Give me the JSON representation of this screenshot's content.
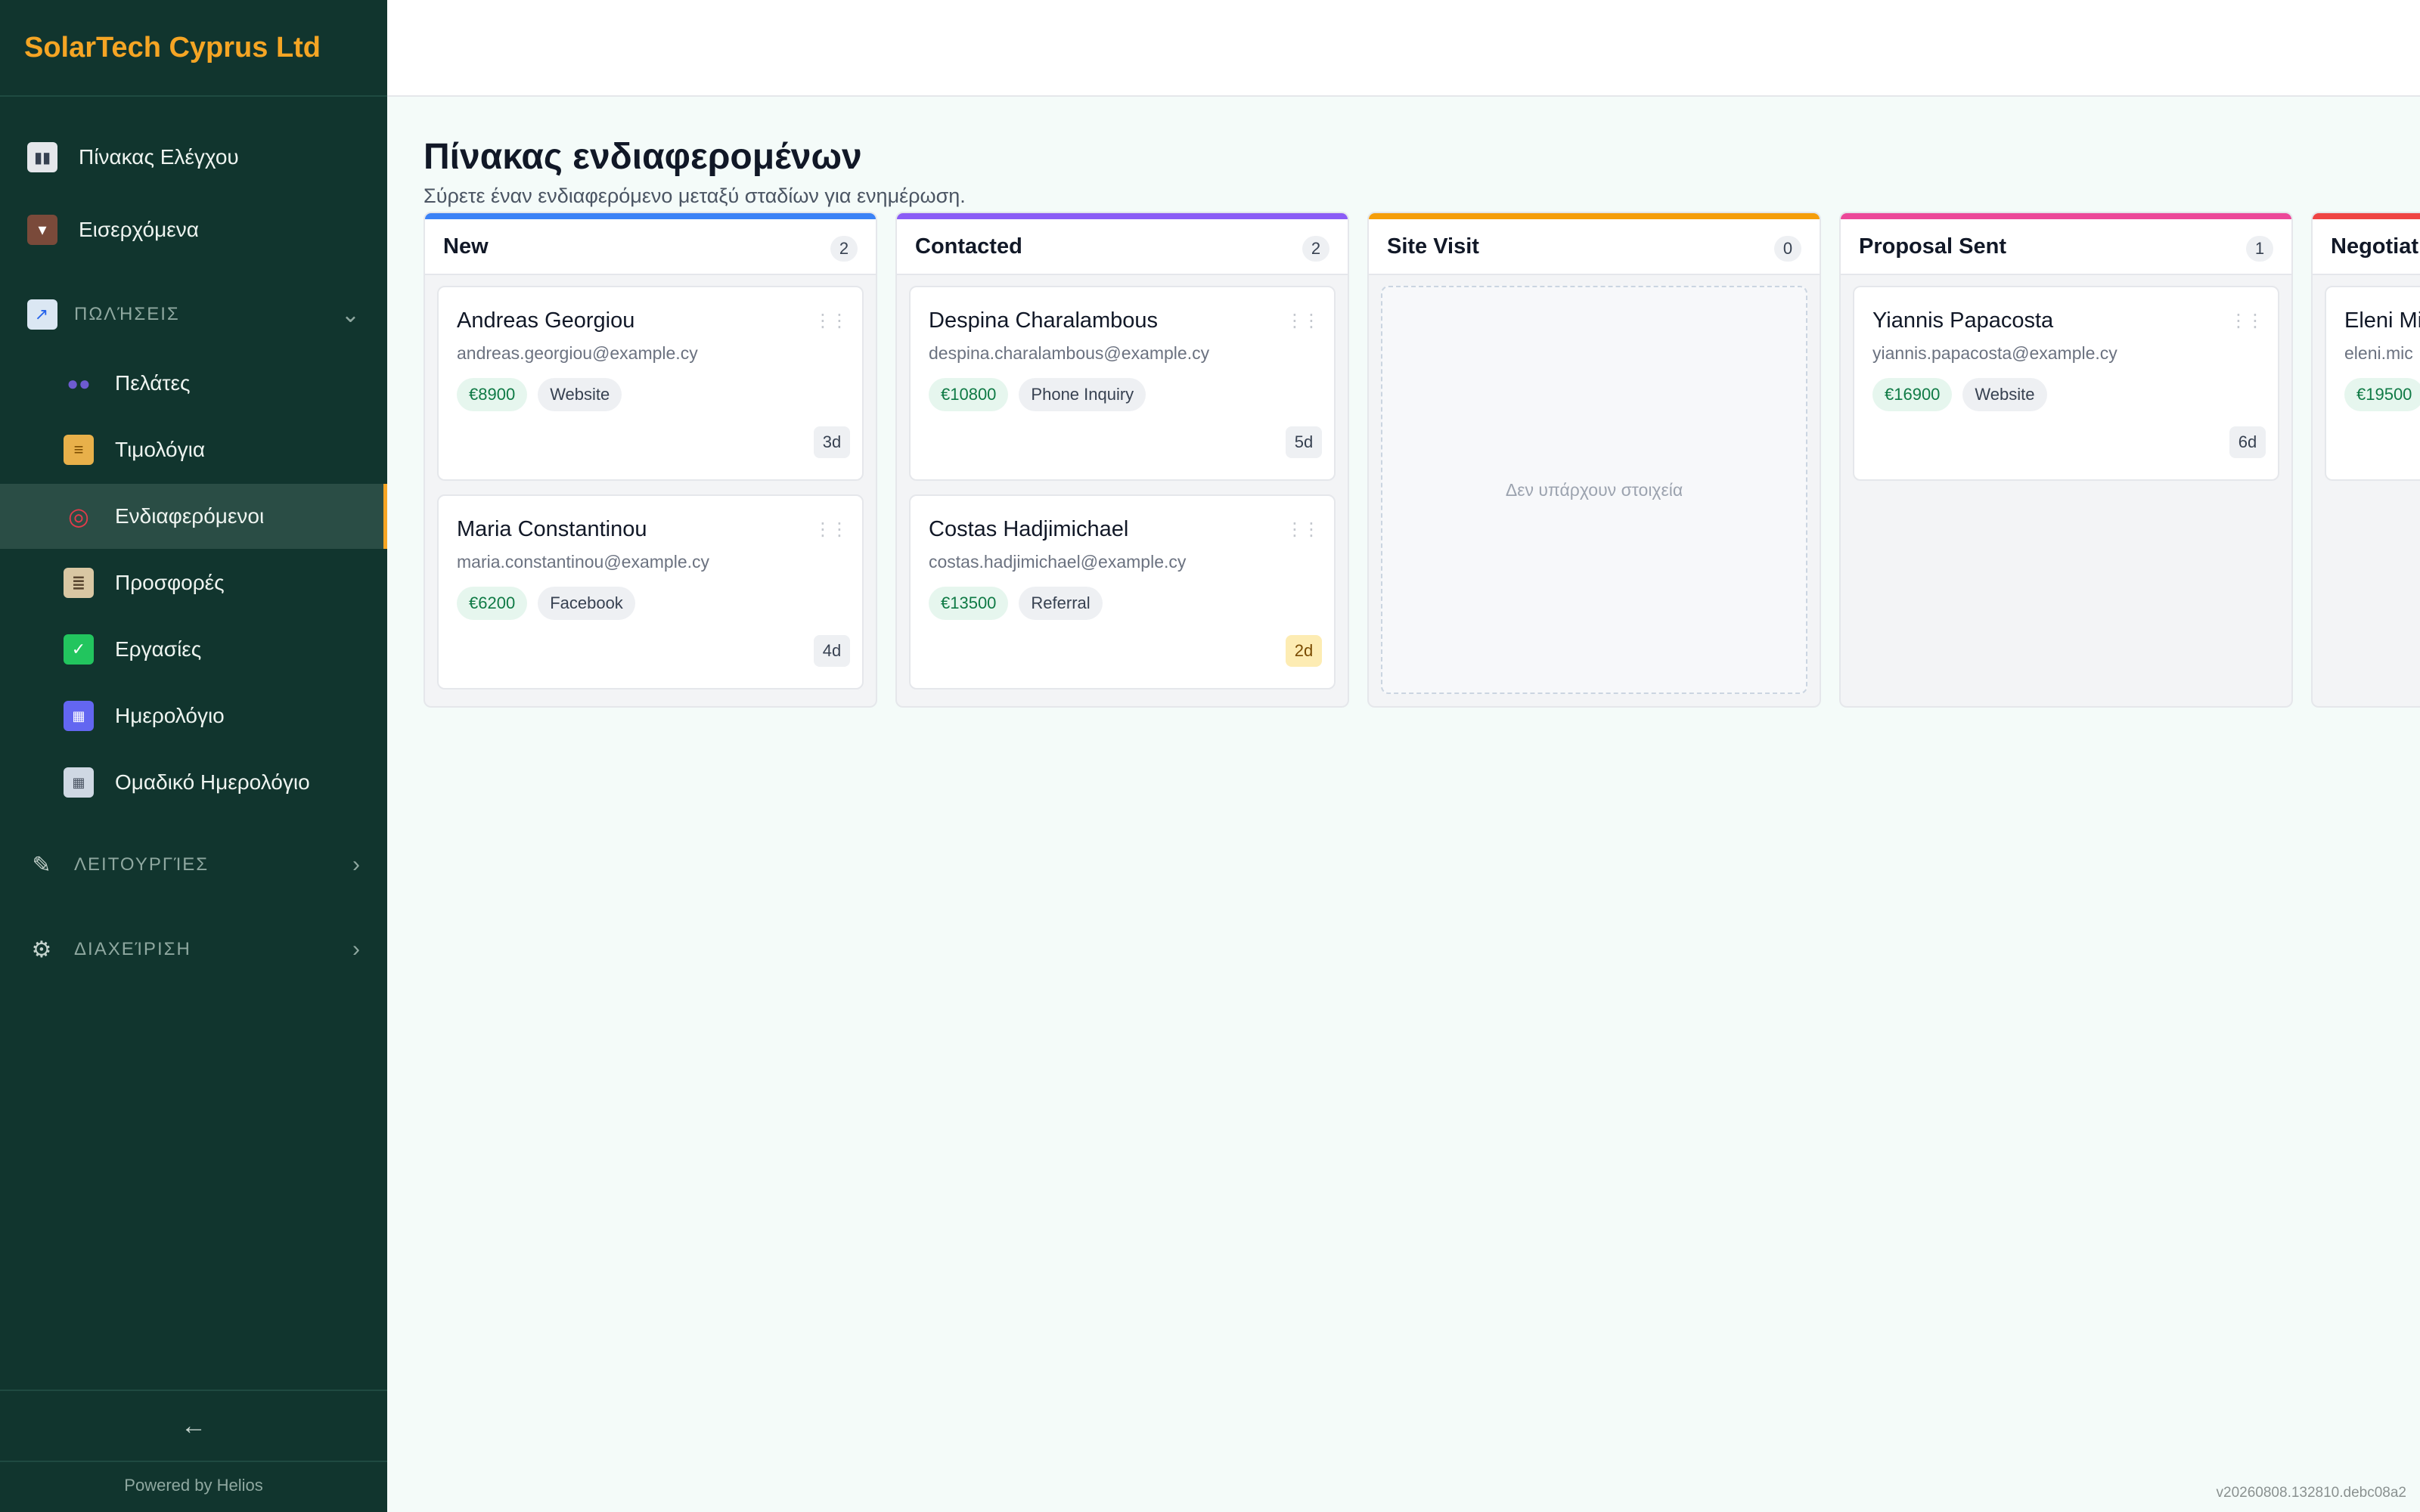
{
  "app": {
    "company": "SolarTech Cyprus Ltd"
  },
  "sidebar": {
    "top_items": [
      {
        "label": "Πίνακας Ελέγχου",
        "icon": "bar-chart-icon"
      },
      {
        "label": "Εισερχόμενα",
        "icon": "inbox-icon"
      }
    ],
    "sections": [
      {
        "label": "ΠΩΛΉΣΕΙΣ",
        "icon": "trend-icon",
        "expanded": true
      },
      {
        "label": "ΛΕΙΤΟΥΡΓΊΕΣ",
        "icon": "wrench-icon",
        "expanded": false
      },
      {
        "label": "ΔΙΑΧΕΊΡΙΣΗ",
        "icon": "gear-icon",
        "expanded": false
      }
    ],
    "sales_items": [
      {
        "label": "Πελάτες",
        "icon": "users-icon"
      },
      {
        "label": "Τιμολόγια",
        "icon": "scroll-icon"
      },
      {
        "label": "Ενδιαφερόμενοι",
        "icon": "target-icon",
        "active": true
      },
      {
        "label": "Προσφορές",
        "icon": "clipboard-icon"
      },
      {
        "label": "Εργασίες",
        "icon": "checkbox-icon"
      },
      {
        "label": "Ημερολόγιο",
        "icon": "calendar-icon"
      },
      {
        "label": "Ομαδικό Ημερολόγιο",
        "icon": "team-calendar-icon"
      }
    ],
    "collapse_glyph": "←",
    "powered_by": "Powered by Helios"
  },
  "main": {
    "title": "Πίνακας ενδιαφερομένων",
    "subtitle": "Σύρετε έναν ενδιαφερόμενο μεταξύ σταδίων για ενημέρωση.",
    "empty_text": "Δεν υπάρχουν στοιχεία",
    "columns": [
      {
        "title": "New",
        "count": "2",
        "color": "#3b82f6",
        "cards": [
          {
            "name": "Andreas Georgiou",
            "email": "andreas.georgiou@example.cy",
            "amount": "€8900",
            "source": "Website",
            "age": "3d",
            "warn": false
          },
          {
            "name": "Maria Constantinou",
            "email": "maria.constantinou@example.cy",
            "amount": "€6200",
            "source": "Facebook",
            "age": "4d",
            "warn": false
          }
        ]
      },
      {
        "title": "Contacted",
        "count": "2",
        "color": "#8b5cf6",
        "cards": [
          {
            "name": "Despina Charalambous",
            "email": "despina.charalambous@example.cy",
            "amount": "€10800",
            "source": "Phone Inquiry",
            "age": "5d",
            "warn": false
          },
          {
            "name": "Costas Hadjimichael",
            "email": "costas.hadjimichael@example.cy",
            "amount": "€13500",
            "source": "Referral",
            "age": "2d",
            "warn": true
          }
        ]
      },
      {
        "title": "Site Visit",
        "count": "0",
        "color": "#f59e0b",
        "cards": []
      },
      {
        "title": "Proposal Sent",
        "count": "1",
        "color": "#ec4899",
        "cards": [
          {
            "name": "Yiannis Papacosta",
            "email": "yiannis.papacosta@example.cy",
            "amount": "€16900",
            "source": "Website",
            "age": "6d",
            "warn": false
          }
        ]
      },
      {
        "title": "Negotiati",
        "count": "",
        "color": "#ef4444",
        "cards": [
          {
            "name": "Eleni Mi",
            "email": "eleni.mic",
            "amount": "€19500",
            "source": "",
            "age": "",
            "warn": false
          }
        ]
      }
    ]
  },
  "footer": {
    "version": "v20260808.132810.debc08a2"
  }
}
